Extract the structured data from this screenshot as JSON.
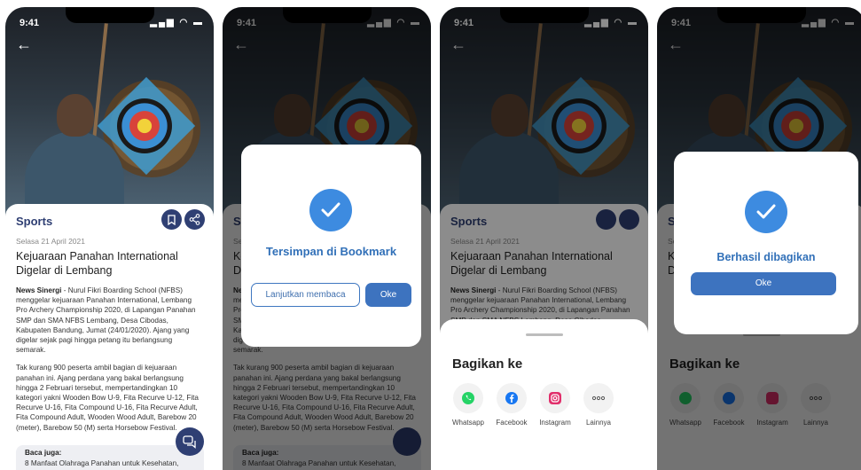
{
  "status": {
    "time": "9:41",
    "icons": "▂▄▆ ◠ ▬"
  },
  "article": {
    "category": "Sports",
    "date": "Selasa 21 April 2021",
    "title": "Kejuaraan Panahan International Digelar di Lembang",
    "source": "News Sinergi",
    "p1": " - Nurul Fikri Boarding School (NFBS) menggelar kejuaraan Panahan International, Lembang Pro Archery Championship 2020, di Lapangan Panahan SMP dan SMA NFBS Lembang, Desa Cibodas, Kabupaten Bandung, Jumat (24/01/2020). Ajang yang digelar sejak pagi hingga petang itu berlangsung semarak.",
    "p2": "Tak kurang 900 peserta ambil bagian di kejuaraan panahan ini. Ajang perdana yang bakal berlangsung hingga 2 Februari tersebut, mempertandingkan 10 kategori yakni Wooden Bow U-9, Fita Recurve U-12, Fita Recurve U-16, Fita Compound U-16, Fita Recurve Adult, Fita Compound Adult, Wooden Wood Adult, Barebow 20 (meter), Barebow 50 (M) serta Horsebow Festival.",
    "related_label": "Baca juga:",
    "related_item": "8 Manfaat Olahraga Panahan untuk Kesehatan,"
  },
  "bookmark_dialog": {
    "title": "Tersimpan di Bookmark",
    "continue_label": "Lanjutkan membaca",
    "ok_label": "Oke"
  },
  "share_sheet": {
    "title": "Bagikan ke",
    "items": [
      {
        "label": "Whatsapp",
        "icon": "whatsapp-icon",
        "color": "#25d366"
      },
      {
        "label": "Facebook",
        "icon": "facebook-icon",
        "color": "#1877f2"
      },
      {
        "label": "Instagram",
        "icon": "instagram-icon",
        "color": "#e1306c"
      },
      {
        "label": "Lainnya",
        "icon": "more-icon",
        "color": "#555555"
      }
    ]
  },
  "share_success_dialog": {
    "title": "Berhasil dibagikan",
    "ok_label": "Oke"
  },
  "colors": {
    "primary": "#2f3f73",
    "accent": "#3d73bf",
    "check": "#3d8be0"
  }
}
